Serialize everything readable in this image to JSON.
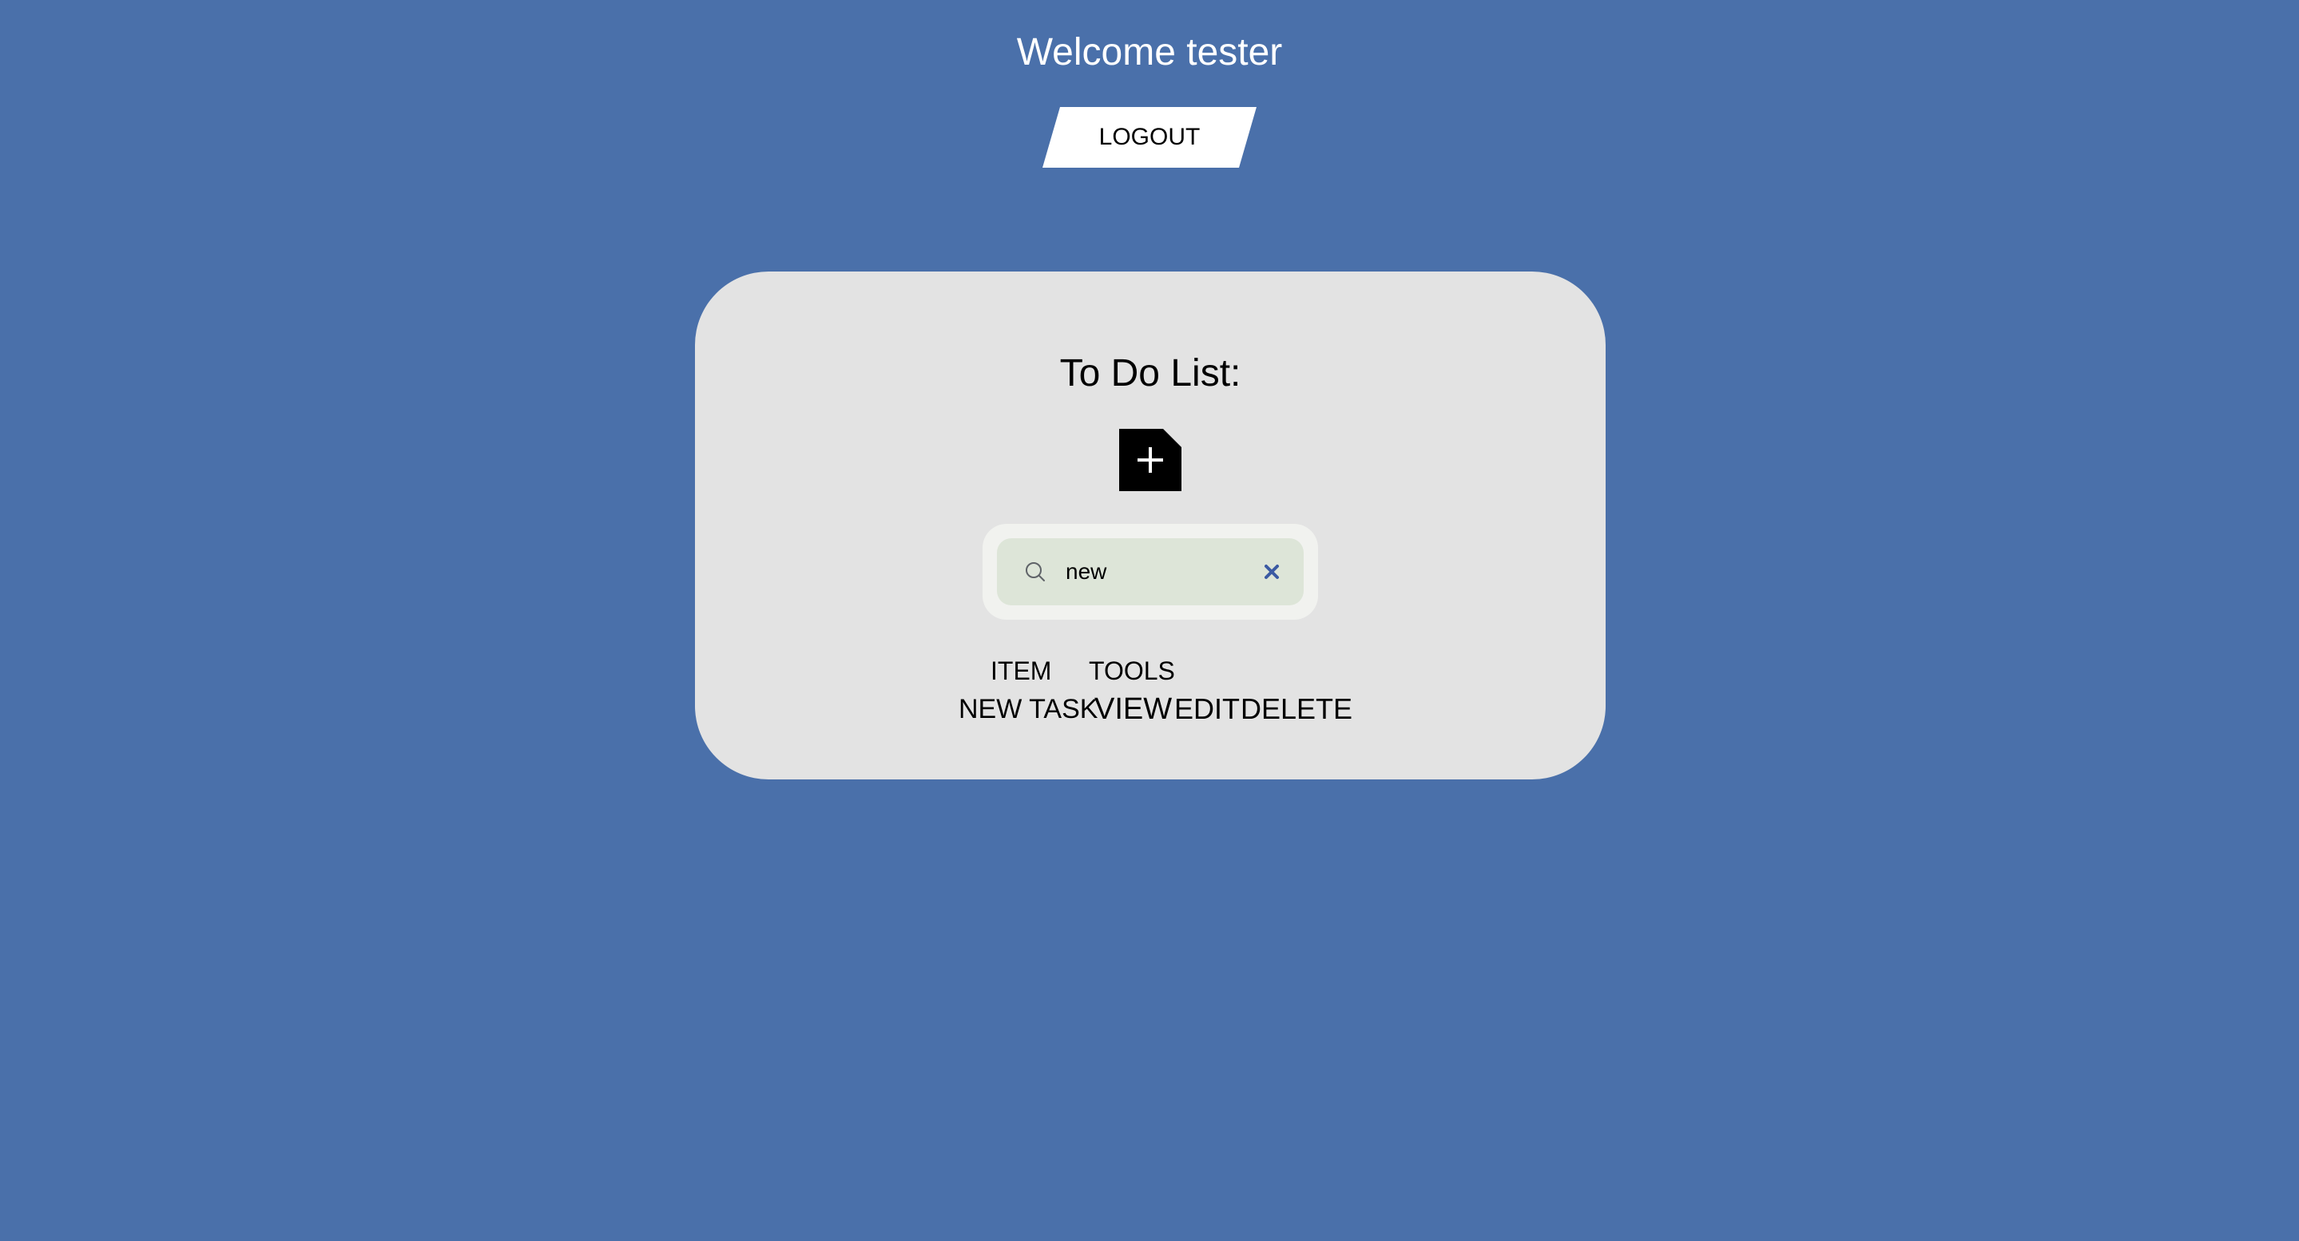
{
  "header": {
    "welcome_text": "Welcome tester",
    "logout_label": "LOGOUT"
  },
  "todo": {
    "title": "To Do List:",
    "add_icon": "file-plus-icon",
    "search": {
      "icon": "search-icon",
      "value": "new",
      "clear_icon": "close-icon"
    },
    "columns": {
      "item": "ITEM",
      "tools": "TOOLS"
    },
    "rows": [
      {
        "name": "NEW TASK",
        "view": "VIEW",
        "edit": "EDIT",
        "delete": "DELETE"
      }
    ]
  },
  "colors": {
    "background": "#4a70aa",
    "card": "#e3e3e3",
    "search_field": "#dde5d8",
    "clear_icon": "#3b5aa3"
  }
}
